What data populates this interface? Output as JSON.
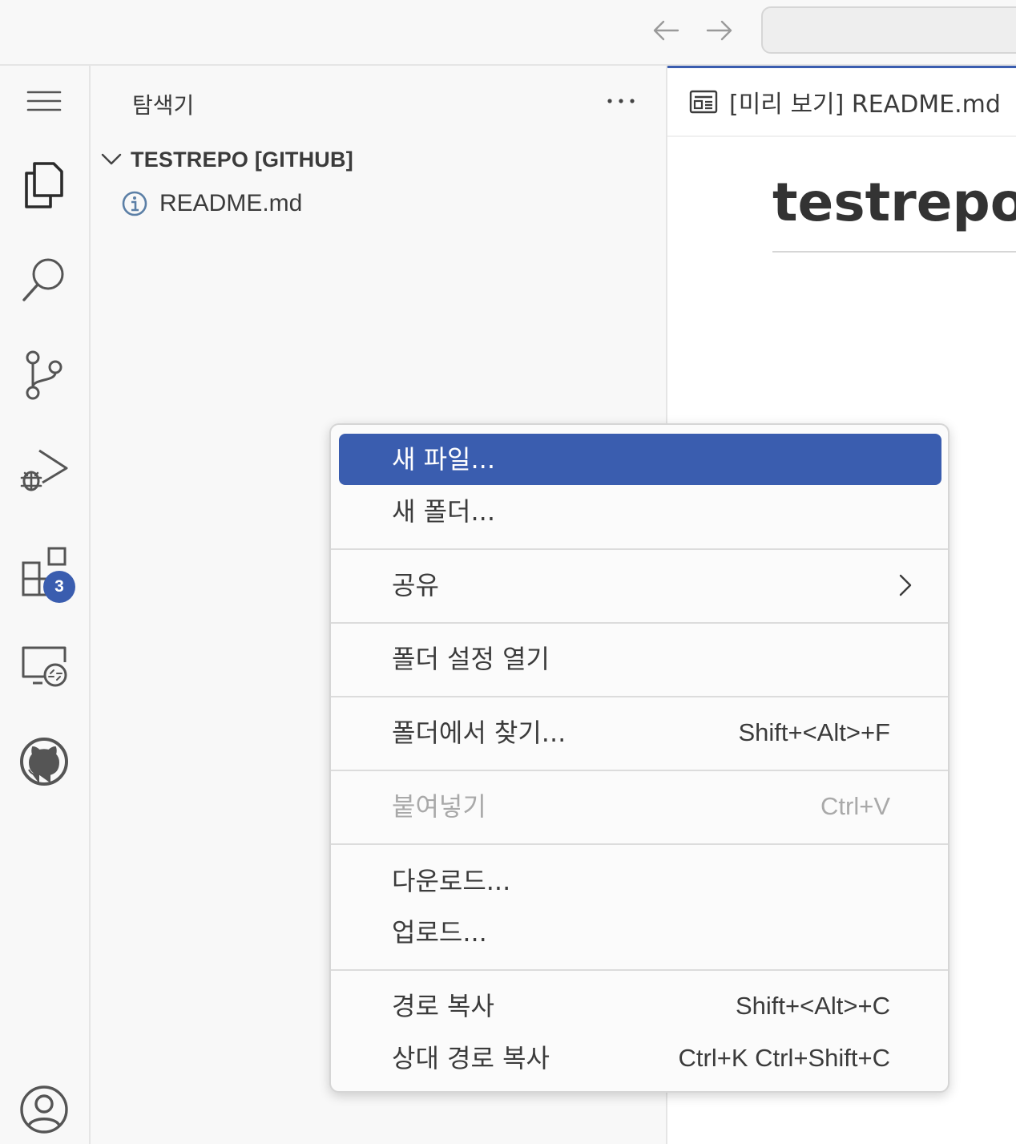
{
  "titlebar": {
    "back_icon": "arrow-left-icon",
    "forward_icon": "arrow-right-icon",
    "command_center_text": ""
  },
  "activity_bar": {
    "items": [
      {
        "name": "menu",
        "icon": "hamburger-menu-icon"
      },
      {
        "name": "explorer",
        "icon": "files-icon"
      },
      {
        "name": "search",
        "icon": "search-icon"
      },
      {
        "name": "source-control",
        "icon": "source-control-icon"
      },
      {
        "name": "run-debug",
        "icon": "run-debug-icon"
      },
      {
        "name": "extensions",
        "icon": "extensions-icon",
        "badge": "3"
      },
      {
        "name": "remote-explorer",
        "icon": "remote-explorer-icon"
      },
      {
        "name": "github",
        "icon": "github-icon"
      },
      {
        "name": "accounts",
        "icon": "account-icon"
      }
    ],
    "accent_color": "#3a5daf"
  },
  "sidebar": {
    "title": "탐색기",
    "more_icon": "ellipsis-icon",
    "folder": {
      "label": "TESTREPO [GITHUB]",
      "expanded": true
    },
    "files": [
      {
        "label": "README.md",
        "icon": "info-icon"
      }
    ]
  },
  "editor": {
    "tab_label": "[미리 보기] README.md",
    "tab_icon": "preview-icon",
    "heading": "testrepo"
  },
  "context_menu": {
    "groups": [
      [
        {
          "label": "새 파일...",
          "shortcut": "",
          "selected": true
        },
        {
          "label": "새 폴더...",
          "shortcut": ""
        }
      ],
      [
        {
          "label": "공유",
          "shortcut": "",
          "submenu": true
        }
      ],
      [
        {
          "label": "폴더 설정 열기",
          "shortcut": ""
        }
      ],
      [
        {
          "label": "폴더에서 찾기...",
          "shortcut": "Shift+<Alt>+F"
        }
      ],
      [
        {
          "label": "붙여넣기",
          "shortcut": "Ctrl+V",
          "disabled": true
        }
      ],
      [
        {
          "label": "다운로드...",
          "shortcut": ""
        },
        {
          "label": "업로드...",
          "shortcut": ""
        }
      ],
      [
        {
          "label": "경로 복사",
          "shortcut": "Shift+<Alt>+C"
        },
        {
          "label": "상대 경로 복사",
          "shortcut": "Ctrl+K Ctrl+Shift+C"
        }
      ]
    ],
    "selected_color": "#3a5daf"
  }
}
